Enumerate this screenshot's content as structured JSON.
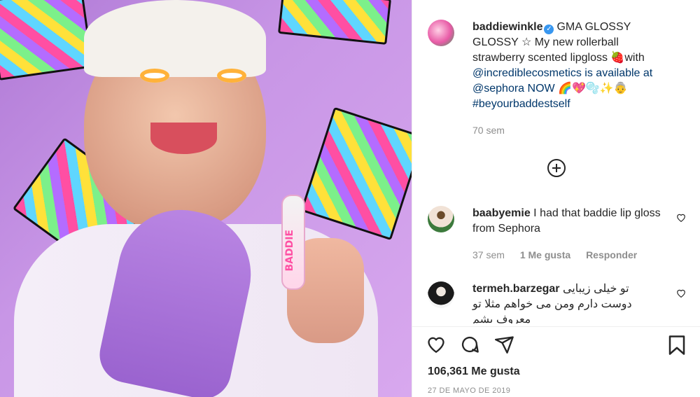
{
  "post": {
    "username": "baddiewinkle",
    "caption_lines": [
      "GMA GLOSSY",
      "GLOSSY ☆ My new rollerball",
      "strawberry scented lipgloss 🍓with",
      "@incrediblecosmetics is available at",
      "@sephora NOW 🌈💖🫧✨👵",
      "#beyourbaddestself"
    ],
    "time": "70 sem",
    "likes": "106,361 Me gusta",
    "date": "27 DE MAYO DE 2019",
    "photo_text": "BADDIE"
  },
  "comments": [
    {
      "username": "baabyemie",
      "text": "I had that baddie lip gloss from Sephora",
      "time": "37 sem",
      "likes": "1 Me gusta",
      "reply": "Responder"
    },
    {
      "username": "termeh.barzegar",
      "text": "تو خیلی زیبایی دوست دارم ومن می خواهم مثلا تو معروف بشم"
    }
  ],
  "icons": {
    "verified": "✓",
    "heart": "heart-icon",
    "comment": "comment-icon",
    "share": "share-icon",
    "save": "bookmark-icon"
  },
  "colors": {
    "link": "#00376b",
    "verified": "#3897f0",
    "photo_bg": "#c896e6"
  }
}
